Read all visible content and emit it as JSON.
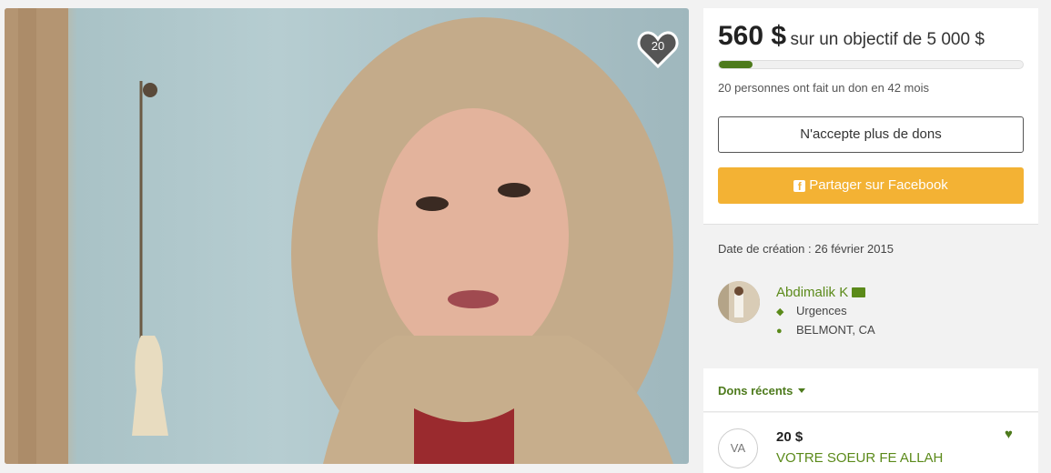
{
  "photo": {
    "heart_count": "20"
  },
  "goal": {
    "amount": "560 $",
    "goal_text": "sur un objectif de 5 000 $",
    "progress_fraction": 0.112,
    "stats": "20 personnes ont fait un don en 42 mois",
    "closed_label": "N'accepte plus de dons",
    "share_label": "Partager sur Facebook",
    "share_color": "#f3b234"
  },
  "info": {
    "created": "Date de création : 26 février 2015",
    "organizer": "Abdimalik K",
    "category": "Urgences",
    "location": "BELMONT, CA"
  },
  "recent": {
    "title": "Dons récents",
    "donation": {
      "initials": "VA",
      "amount": "20 $",
      "name": "VOTRE SOEUR FE ALLAH"
    }
  },
  "colors": {
    "accent_green": "#4d7a1c",
    "link_green": "#5b8a1a"
  }
}
